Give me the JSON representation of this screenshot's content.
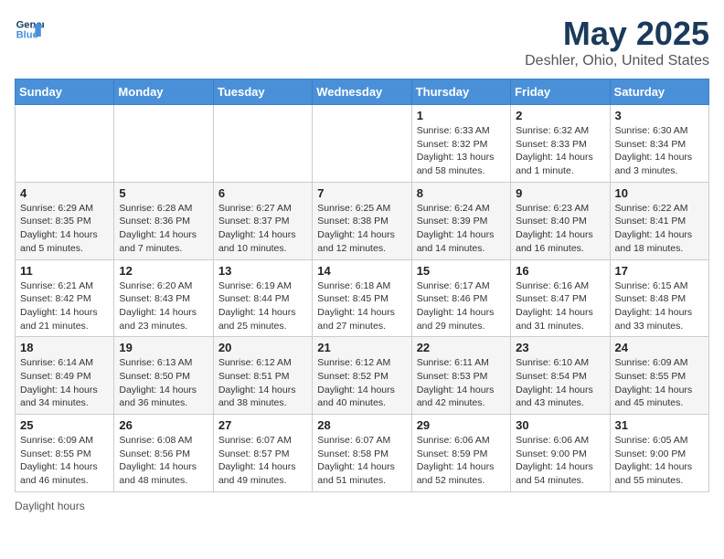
{
  "logo": {
    "line1": "General",
    "line2": "Blue"
  },
  "title": "May 2025",
  "location": "Deshler, Ohio, United States",
  "days_of_week": [
    "Sunday",
    "Monday",
    "Tuesday",
    "Wednesday",
    "Thursday",
    "Friday",
    "Saturday"
  ],
  "footer_text": "Daylight hours",
  "weeks": [
    [
      {
        "day": "",
        "info": ""
      },
      {
        "day": "",
        "info": ""
      },
      {
        "day": "",
        "info": ""
      },
      {
        "day": "",
        "info": ""
      },
      {
        "day": "1",
        "info": "Sunrise: 6:33 AM\nSunset: 8:32 PM\nDaylight: 13 hours\nand 58 minutes."
      },
      {
        "day": "2",
        "info": "Sunrise: 6:32 AM\nSunset: 8:33 PM\nDaylight: 14 hours\nand 1 minute."
      },
      {
        "day": "3",
        "info": "Sunrise: 6:30 AM\nSunset: 8:34 PM\nDaylight: 14 hours\nand 3 minutes."
      }
    ],
    [
      {
        "day": "4",
        "info": "Sunrise: 6:29 AM\nSunset: 8:35 PM\nDaylight: 14 hours\nand 5 minutes."
      },
      {
        "day": "5",
        "info": "Sunrise: 6:28 AM\nSunset: 8:36 PM\nDaylight: 14 hours\nand 7 minutes."
      },
      {
        "day": "6",
        "info": "Sunrise: 6:27 AM\nSunset: 8:37 PM\nDaylight: 14 hours\nand 10 minutes."
      },
      {
        "day": "7",
        "info": "Sunrise: 6:25 AM\nSunset: 8:38 PM\nDaylight: 14 hours\nand 12 minutes."
      },
      {
        "day": "8",
        "info": "Sunrise: 6:24 AM\nSunset: 8:39 PM\nDaylight: 14 hours\nand 14 minutes."
      },
      {
        "day": "9",
        "info": "Sunrise: 6:23 AM\nSunset: 8:40 PM\nDaylight: 14 hours\nand 16 minutes."
      },
      {
        "day": "10",
        "info": "Sunrise: 6:22 AM\nSunset: 8:41 PM\nDaylight: 14 hours\nand 18 minutes."
      }
    ],
    [
      {
        "day": "11",
        "info": "Sunrise: 6:21 AM\nSunset: 8:42 PM\nDaylight: 14 hours\nand 21 minutes."
      },
      {
        "day": "12",
        "info": "Sunrise: 6:20 AM\nSunset: 8:43 PM\nDaylight: 14 hours\nand 23 minutes."
      },
      {
        "day": "13",
        "info": "Sunrise: 6:19 AM\nSunset: 8:44 PM\nDaylight: 14 hours\nand 25 minutes."
      },
      {
        "day": "14",
        "info": "Sunrise: 6:18 AM\nSunset: 8:45 PM\nDaylight: 14 hours\nand 27 minutes."
      },
      {
        "day": "15",
        "info": "Sunrise: 6:17 AM\nSunset: 8:46 PM\nDaylight: 14 hours\nand 29 minutes."
      },
      {
        "day": "16",
        "info": "Sunrise: 6:16 AM\nSunset: 8:47 PM\nDaylight: 14 hours\nand 31 minutes."
      },
      {
        "day": "17",
        "info": "Sunrise: 6:15 AM\nSunset: 8:48 PM\nDaylight: 14 hours\nand 33 minutes."
      }
    ],
    [
      {
        "day": "18",
        "info": "Sunrise: 6:14 AM\nSunset: 8:49 PM\nDaylight: 14 hours\nand 34 minutes."
      },
      {
        "day": "19",
        "info": "Sunrise: 6:13 AM\nSunset: 8:50 PM\nDaylight: 14 hours\nand 36 minutes."
      },
      {
        "day": "20",
        "info": "Sunrise: 6:12 AM\nSunset: 8:51 PM\nDaylight: 14 hours\nand 38 minutes."
      },
      {
        "day": "21",
        "info": "Sunrise: 6:12 AM\nSunset: 8:52 PM\nDaylight: 14 hours\nand 40 minutes."
      },
      {
        "day": "22",
        "info": "Sunrise: 6:11 AM\nSunset: 8:53 PM\nDaylight: 14 hours\nand 42 minutes."
      },
      {
        "day": "23",
        "info": "Sunrise: 6:10 AM\nSunset: 8:54 PM\nDaylight: 14 hours\nand 43 minutes."
      },
      {
        "day": "24",
        "info": "Sunrise: 6:09 AM\nSunset: 8:55 PM\nDaylight: 14 hours\nand 45 minutes."
      }
    ],
    [
      {
        "day": "25",
        "info": "Sunrise: 6:09 AM\nSunset: 8:55 PM\nDaylight: 14 hours\nand 46 minutes."
      },
      {
        "day": "26",
        "info": "Sunrise: 6:08 AM\nSunset: 8:56 PM\nDaylight: 14 hours\nand 48 minutes."
      },
      {
        "day": "27",
        "info": "Sunrise: 6:07 AM\nSunset: 8:57 PM\nDaylight: 14 hours\nand 49 minutes."
      },
      {
        "day": "28",
        "info": "Sunrise: 6:07 AM\nSunset: 8:58 PM\nDaylight: 14 hours\nand 51 minutes."
      },
      {
        "day": "29",
        "info": "Sunrise: 6:06 AM\nSunset: 8:59 PM\nDaylight: 14 hours\nand 52 minutes."
      },
      {
        "day": "30",
        "info": "Sunrise: 6:06 AM\nSunset: 9:00 PM\nDaylight: 14 hours\nand 54 minutes."
      },
      {
        "day": "31",
        "info": "Sunrise: 6:05 AM\nSunset: 9:00 PM\nDaylight: 14 hours\nand 55 minutes."
      }
    ]
  ]
}
